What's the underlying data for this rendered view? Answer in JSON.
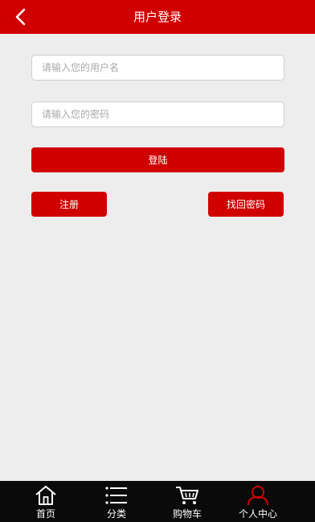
{
  "header": {
    "title": "用户登录",
    "back_icon": "chevron-left-icon"
  },
  "login_form": {
    "username_placeholder": "请输入您的用户名",
    "username_value": "",
    "password_placeholder": "请输入您的密码",
    "password_value": "",
    "login_label": "登陆",
    "register_label": "注册",
    "recover_label": "找回密码"
  },
  "tabbar": {
    "items": [
      {
        "label": "首页",
        "icon": "home-icon"
      },
      {
        "label": "分类",
        "icon": "list-icon"
      },
      {
        "label": "购物车",
        "icon": "cart-icon"
      },
      {
        "label": "个人中心",
        "icon": "user-icon",
        "active": true
      }
    ]
  },
  "colors": {
    "brand_red": "#d10000",
    "background": "#ededed",
    "tabbar_bg": "#0a0a0a",
    "active_icon": "#d10000"
  }
}
